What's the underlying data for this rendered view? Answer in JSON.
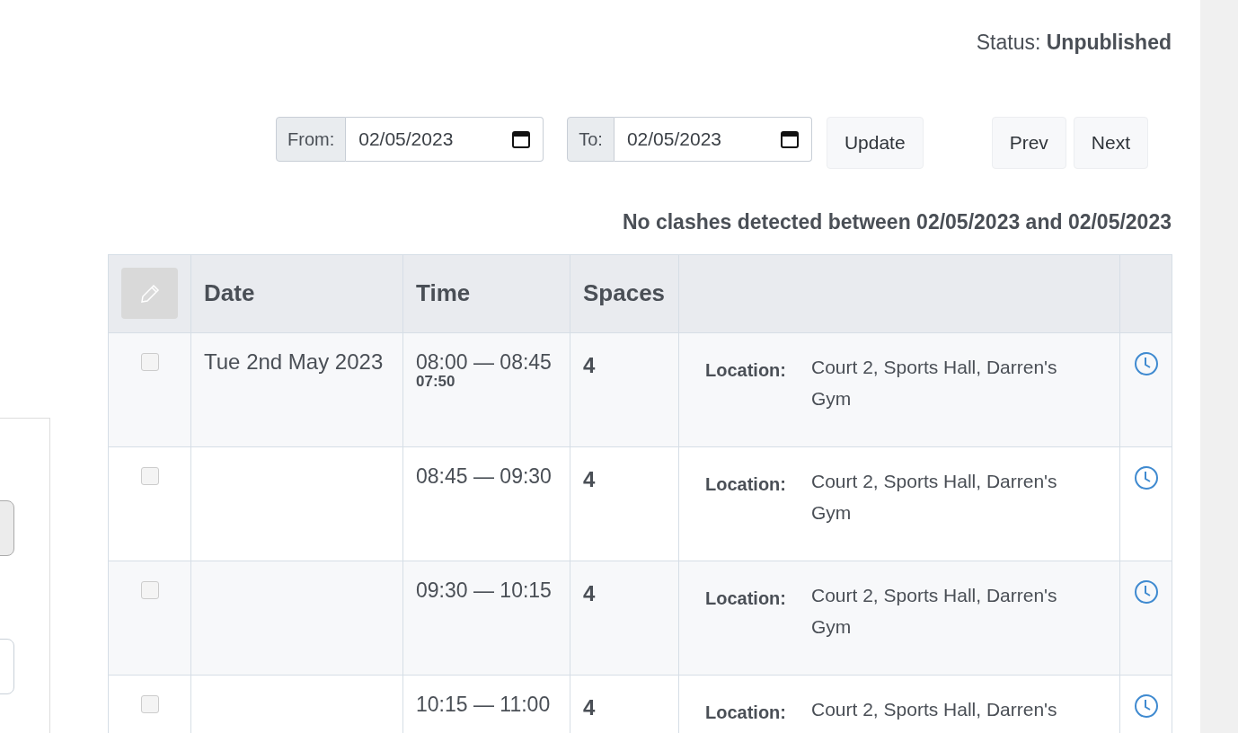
{
  "status": {
    "label": "Status:",
    "value": "Unpublished"
  },
  "filters": {
    "from": {
      "label": "From:",
      "value": "02/05/2023"
    },
    "to": {
      "label": "To:",
      "value": "02/05/2023"
    },
    "update": "Update",
    "prev": "Prev",
    "next": "Next"
  },
  "message": "No clashes detected between 02/05/2023 and 02/05/2023",
  "table": {
    "columns": [
      "Date",
      "Time",
      "Spaces"
    ],
    "rows": [
      {
        "checked": false,
        "date": "Tue 2nd May 2023",
        "time": "08:00 — 08:45",
        "sub_time": "07:50",
        "spaces": "4",
        "location_label": "Location:",
        "location": "Court 2, Sports Hall, Darren's Gym"
      },
      {
        "checked": false,
        "time": "08:45 — 09:30",
        "spaces": "4",
        "location_label": "Location:",
        "location": "Court 2, Sports Hall, Darren's Gym"
      },
      {
        "checked": false,
        "time": "09:30 — 10:15",
        "spaces": "4",
        "location_label": "Location:",
        "location": "Court 2, Sports Hall, Darren's Gym"
      },
      {
        "checked": false,
        "time": "10:15 — 11:00",
        "spaces": "4",
        "location_label": "Location:",
        "location": "Court 2, Sports Hall, Darren's"
      }
    ]
  }
}
